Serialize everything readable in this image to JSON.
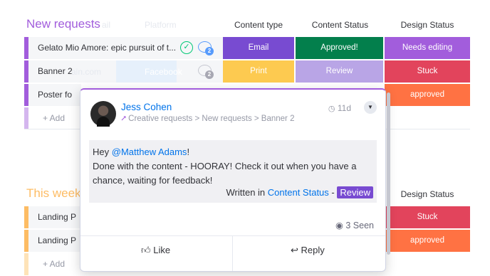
{
  "board": {
    "group1": {
      "title": "New requests",
      "ghost_texts": [
        "ail",
        "Platform",
        "ain.com",
        "Facebook"
      ],
      "columns": [
        "Content type",
        "Content Status",
        "Design Status"
      ],
      "rows": [
        {
          "name": "Gelato Mio Amore: epic pursuit of t...",
          "type": "Email",
          "content_status": "Approved!",
          "design_status": "Needs editing",
          "comment_count": "2"
        },
        {
          "name": "Banner 2",
          "type": "Print",
          "content_status": "Review",
          "design_status": "Stuck",
          "comment_count": "2"
        },
        {
          "name": "Poster fo",
          "design_status": "approved"
        }
      ],
      "add_label": "+ Add"
    },
    "group2": {
      "title": "This week",
      "columns": [
        "Design Status"
      ],
      "rows": [
        {
          "name": "Landing P",
          "design_status": "Stuck"
        },
        {
          "name": "Landing P",
          "design_status": "approved"
        }
      ],
      "add_label": "+ Add"
    },
    "colors": {
      "purple_group": "#a25ddc",
      "yellow_group": "#fdbc64",
      "email": "#784bd1",
      "print": "#fdca50",
      "approved_green": "#037f4c",
      "review": "#b9a5e6",
      "needs_editing": "#a25ddc",
      "stuck": "#e2445c",
      "approved_orange": "#ff7243"
    }
  },
  "update": {
    "author": "Jess Cohen",
    "path": "Creative requests > New requests > Banner 2",
    "time": "11d",
    "message_greeting": "Hey",
    "mention": "@Matthew Adams",
    "greeting_end": "!",
    "message_body": "Done with the content - HOORAY! Check it out when you have a chance, waiting for feedback!",
    "written_in_prefix": "Written in",
    "written_in_column": "Content Status",
    "written_in_separator": "-",
    "written_in_value": "Review",
    "seen": "3 Seen",
    "like_label": "Like",
    "reply_label": "Reply"
  }
}
